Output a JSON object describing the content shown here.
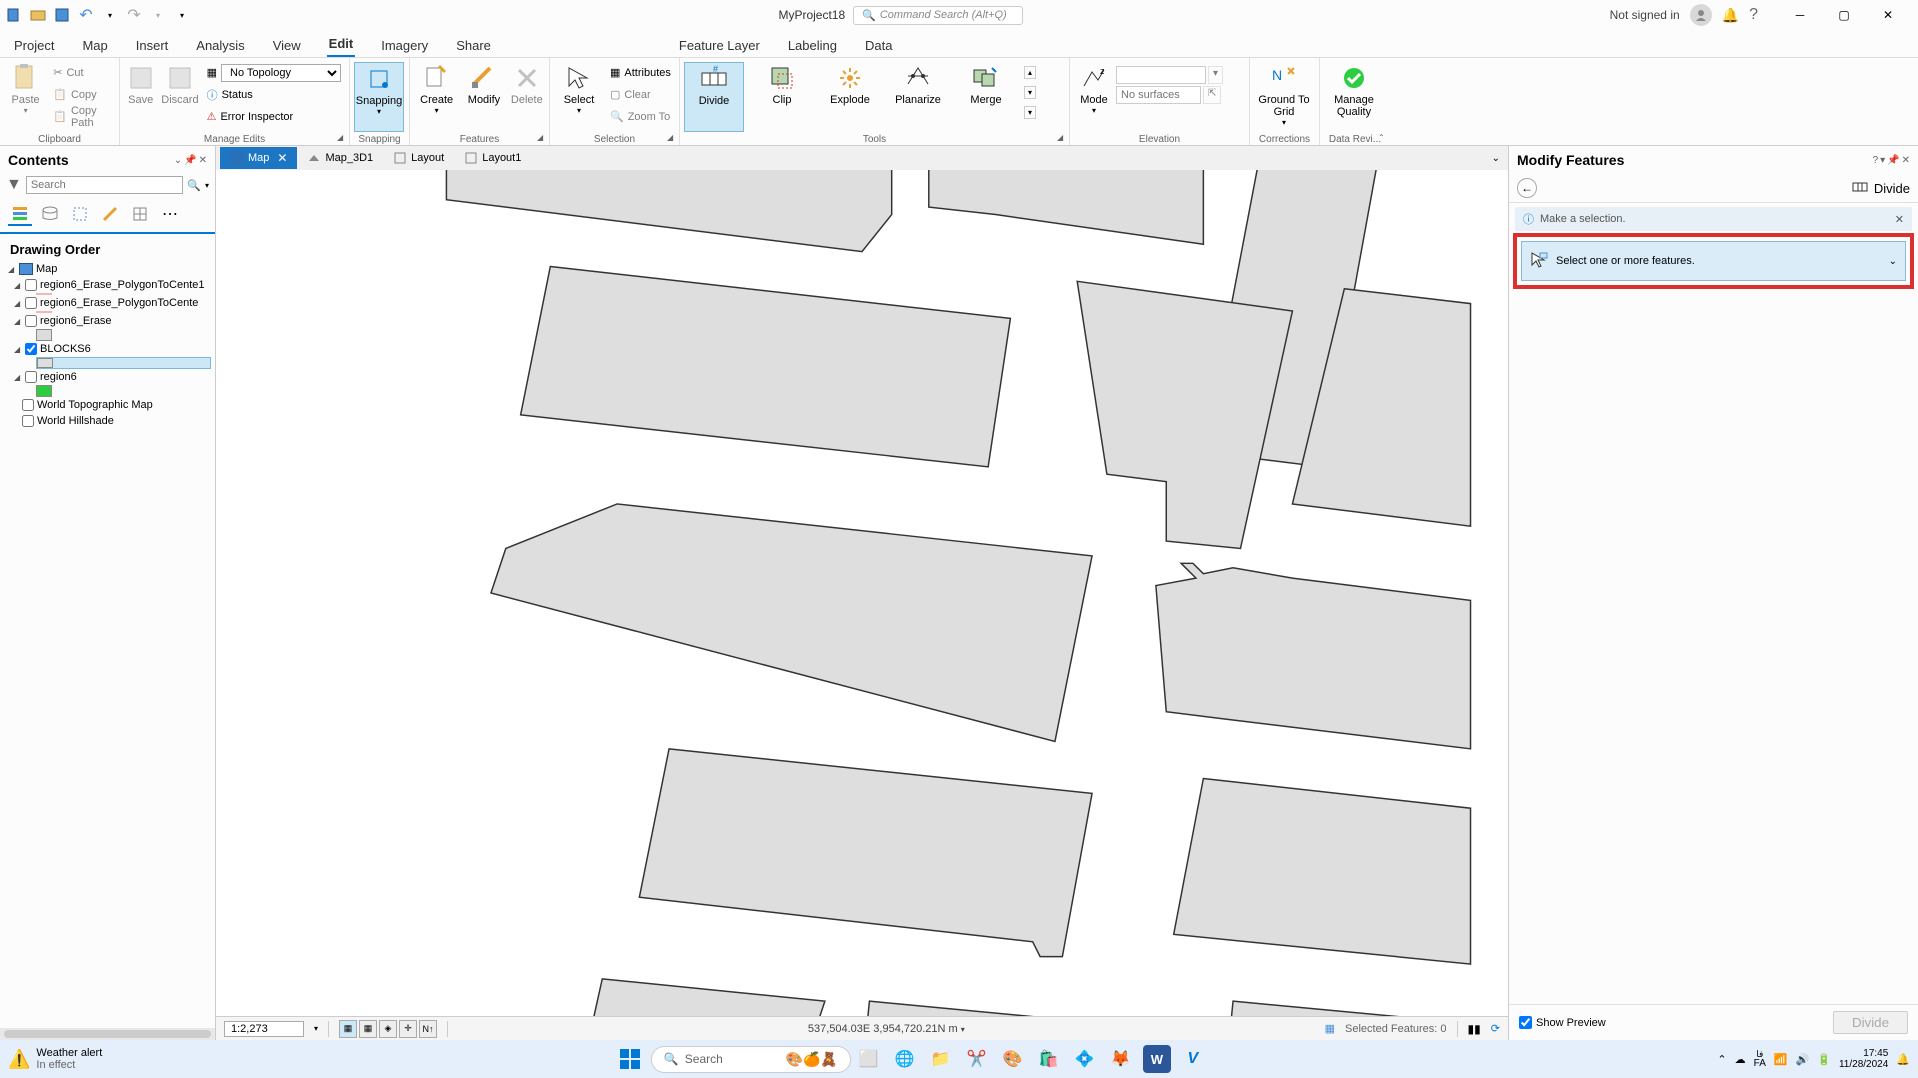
{
  "titlebar": {
    "project_name": "MyProject18",
    "search_placeholder": "Command Search (Alt+Q)",
    "signin": "Not signed in"
  },
  "main_tabs": [
    "Project",
    "Map",
    "Insert",
    "Analysis",
    "View",
    "Edit",
    "Imagery",
    "Share"
  ],
  "context_tabs": [
    "Feature Layer",
    "Labeling",
    "Data"
  ],
  "active_tab": "Edit",
  "ribbon": {
    "clipboard": {
      "label": "Clipboard",
      "paste": "Paste",
      "cut": "Cut",
      "copy": "Copy",
      "copy_path": "Copy Path"
    },
    "manage_edits": {
      "label": "Manage Edits",
      "save": "Save",
      "discard": "Discard",
      "topology": "No Topology",
      "status": "Status",
      "error_inspector": "Error Inspector"
    },
    "snapping": {
      "label": "Snapping",
      "snapping": "Snapping"
    },
    "features": {
      "label": "Features",
      "create": "Create",
      "modify": "Modify",
      "delete": "Delete"
    },
    "selection": {
      "label": "Selection",
      "select": "Select",
      "attributes": "Attributes",
      "clear": "Clear",
      "zoom_to": "Zoom To"
    },
    "tools": {
      "label": "Tools",
      "divide": "Divide",
      "clip": "Clip",
      "explode": "Explode",
      "planarize": "Planarize",
      "merge": "Merge"
    },
    "elevation": {
      "label": "Elevation",
      "mode": "Mode",
      "no_surfaces": "No surfaces"
    },
    "corrections": {
      "label": "Corrections",
      "ground_to_grid": "Ground To Grid"
    },
    "data_rev": {
      "label": "Data Revi...",
      "manage_quality": "Manage Quality"
    }
  },
  "view_tabs": [
    {
      "label": "Map",
      "active": true,
      "closable": true
    },
    {
      "label": "Map_3D1",
      "active": false
    },
    {
      "label": "Layout",
      "active": false
    },
    {
      "label": "Layout1",
      "active": false
    }
  ],
  "contents": {
    "title": "Contents",
    "search_placeholder": "Search",
    "heading": "Drawing Order",
    "map_name": "Map",
    "layers": [
      {
        "name": "region6_Erase_PolygonToCente1",
        "checked": false,
        "swatch": "#f0b8b0"
      },
      {
        "name": "region6_Erase_PolygonToCente",
        "checked": false,
        "swatch": "#f0b8b0"
      },
      {
        "name": "region6_Erase",
        "checked": false,
        "swatch": "#dcdcdc"
      },
      {
        "name": "BLOCKS6",
        "checked": true,
        "swatch": "#dedede",
        "selected": true
      },
      {
        "name": "region6",
        "checked": false,
        "swatch": "#2ecc40"
      },
      {
        "name": "World Topographic Map",
        "checked": false
      },
      {
        "name": "World Hillshade",
        "checked": false
      }
    ]
  },
  "status": {
    "scale": "1:2,273",
    "coords": "537,504.03E 3,954,720.21N m",
    "selected_features": "Selected Features: 0"
  },
  "modify": {
    "title": "Modify Features",
    "tool": "Divide",
    "banner": "Make a selection.",
    "select_prompt": "Select one or more features.",
    "show_preview": "Show Preview",
    "divide_btn": "Divide"
  },
  "taskbar": {
    "weather_title": "Weather alert",
    "weather_sub": "In effect",
    "search": "Search",
    "lang": "FA",
    "lang_code": "فا",
    "time": "17:45",
    "date": "11/28/2024"
  }
}
